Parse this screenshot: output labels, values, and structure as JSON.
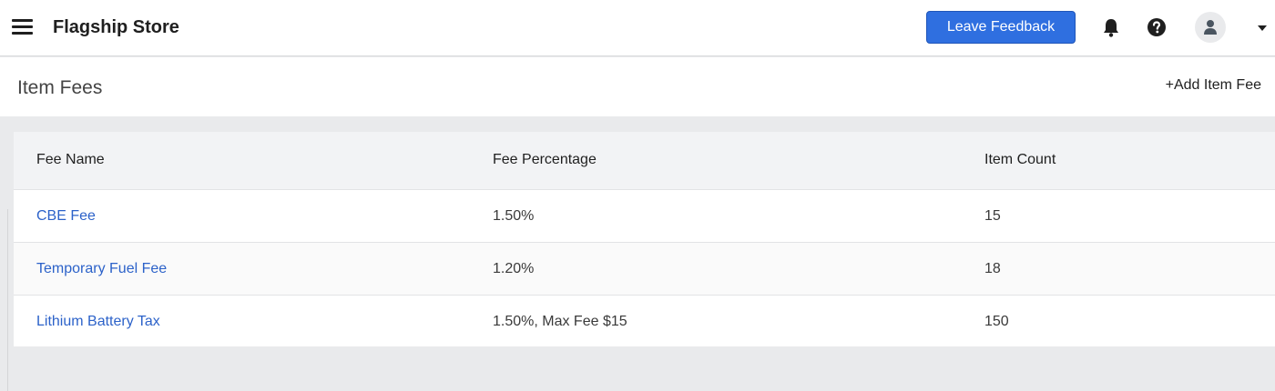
{
  "topbar": {
    "store_name": "Flagship Store",
    "feedback_label": "Leave Feedback",
    "icons": [
      "menu-icon",
      "bell-icon",
      "help-icon",
      "user-icon",
      "caret-down-icon"
    ],
    "accent_color": "#2f6fe0"
  },
  "page": {
    "title": "Item Fees",
    "add_label": "+Add Item Fee"
  },
  "table": {
    "headers": [
      "Fee Name",
      "Fee Percentage",
      "Item Count"
    ],
    "rows": [
      {
        "name": "CBE Fee",
        "percentage": "1.50%",
        "count": "15"
      },
      {
        "name": "Temporary Fuel Fee",
        "percentage": "1.20%",
        "count": "18"
      },
      {
        "name": "Lithium Battery Tax",
        "percentage": "1.50%, Max Fee $15",
        "count": "150"
      }
    ],
    "link_color": "#2c62c9"
  }
}
